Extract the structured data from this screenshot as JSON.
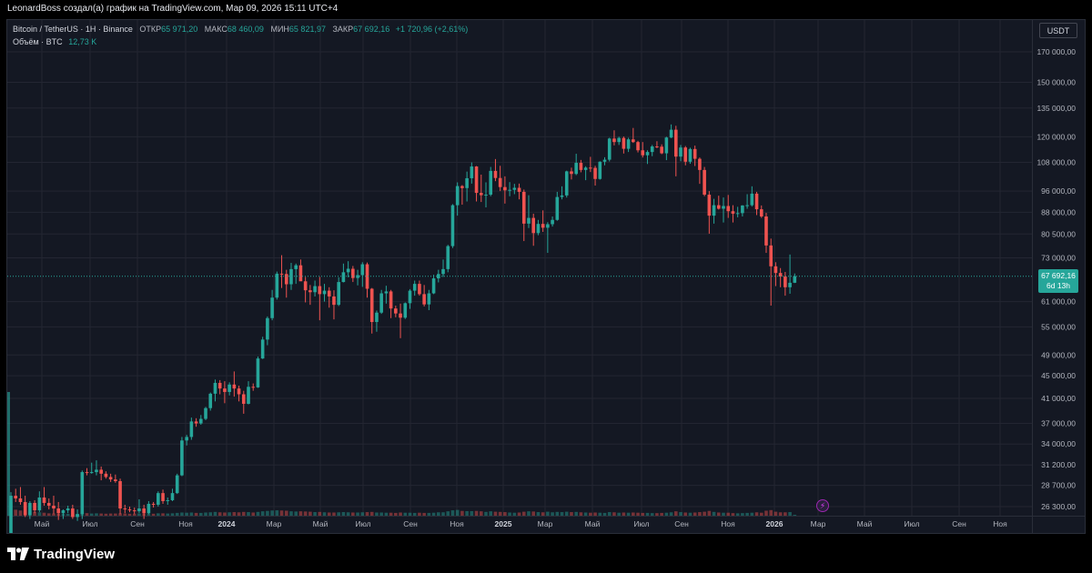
{
  "caption": "LeonardBoss создал(а) график на TradingView.com, Мар 09, 2026 15:11 UTC+4",
  "legend": {
    "symbol": "Bitcoin / TetherUS · 1Н · Binance",
    "open_label": "ОТКР",
    "open_value": "65 971,20",
    "high_label": "МАКС",
    "high_value": "68 460,09",
    "low_label": "МИН",
    "low_value": "65 821,97",
    "close_label": "ЗАКР",
    "close_value": "67 692,16",
    "change": "+1 720,96 (+2,61%)",
    "volume_label": "Объём · BTC",
    "volume_value": "12,73 K"
  },
  "currency": "USDT",
  "last_price": {
    "price": "67 692,16",
    "countdown": "6d 13h"
  },
  "logo_text": "TradingView",
  "icons": {
    "flash": "lightning-icon",
    "logo": "tradingview-logo-icon"
  },
  "colors": {
    "up": "#26a69a",
    "down": "#ef5350",
    "background": "#141823",
    "grid": "#232632"
  },
  "chart_data": {
    "type": "candlestick",
    "scale": "log",
    "interval": "1W",
    "grid": true,
    "y_ticks": [
      26300,
      28700,
      31200,
      34000,
      37000,
      41000,
      45000,
      49000,
      55000,
      61000,
      67692.16,
      73000,
      80500,
      88000,
      96000,
      108000,
      120000,
      135000,
      150000,
      170000
    ],
    "y_tick_labels": [
      "26 300,00",
      "28 700,00",
      "31 200,00",
      "34 000,00",
      "37 000,00",
      "41 000,00",
      "45 000,00",
      "49 000,00",
      "55 000,00",
      "61 000,00",
      "67 692,16",
      "73 000,00",
      "80 500,00",
      "88 000,00",
      "96 000,00",
      "108 000,00",
      "120 000,00",
      "135 000,00",
      "150 000,00",
      "170 000,00"
    ],
    "x_tick_labels": [
      "Май",
      "Июл",
      "Сен",
      "Ноя",
      "2024",
      "Мар",
      "Май",
      "Июл",
      "Сен",
      "Ноя",
      "2025",
      "Мар",
      "Май",
      "Июл",
      "Сен",
      "Ноя",
      "2026",
      "Мар",
      "Май",
      "Июл",
      "Сен",
      "Ноя"
    ],
    "x_tick_bold": [
      false,
      false,
      false,
      false,
      true,
      false,
      false,
      false,
      false,
      false,
      true,
      false,
      false,
      false,
      false,
      false,
      true,
      false,
      false,
      false,
      false,
      false
    ],
    "candles": [
      [
        23500,
        27900,
        22500,
        27500,
        70
      ],
      [
        27500,
        28300,
        26800,
        27200,
        30
      ],
      [
        27200,
        28500,
        26500,
        26800,
        26
      ],
      [
        26800,
        27500,
        25200,
        25400,
        22
      ],
      [
        25400,
        26900,
        25000,
        26700,
        21
      ],
      [
        26700,
        27000,
        25600,
        25900,
        19
      ],
      [
        25900,
        28000,
        25700,
        27300,
        17
      ],
      [
        27300,
        28500,
        26400,
        26700,
        15
      ],
      [
        26700,
        27200,
        26000,
        26400,
        12
      ],
      [
        26400,
        27500,
        25500,
        26100,
        11
      ],
      [
        26100,
        26800,
        24900,
        25600,
        10
      ],
      [
        25600,
        26000,
        25000,
        25900,
        9
      ],
      [
        25900,
        26400,
        25600,
        26100,
        9
      ],
      [
        26100,
        26500,
        25000,
        25200,
        10
      ],
      [
        25200,
        26000,
        24800,
        25500,
        9
      ],
      [
        25500,
        30500,
        25000,
        30300,
        14
      ],
      [
        30300,
        30800,
        29900,
        30200,
        13
      ],
      [
        30200,
        31500,
        30100,
        30300,
        11
      ],
      [
        30300,
        31800,
        29900,
        30600,
        12
      ],
      [
        30600,
        31000,
        29300,
        30100,
        11
      ],
      [
        30100,
        30400,
        29500,
        29700,
        10
      ],
      [
        29700,
        30100,
        29100,
        29400,
        11
      ],
      [
        29400,
        30000,
        29000,
        29200,
        11
      ],
      [
        29200,
        29500,
        25500,
        26100,
        12
      ],
      [
        26100,
        26500,
        25600,
        26000,
        11
      ],
      [
        26000,
        26300,
        25700,
        25900,
        10
      ],
      [
        25900,
        26200,
        25500,
        25800,
        10
      ],
      [
        25800,
        27100,
        25600,
        26100,
        11
      ],
      [
        26100,
        26500,
        25000,
        25600,
        11
      ],
      [
        25600,
        26900,
        25500,
        26600,
        11
      ],
      [
        26600,
        26800,
        26200,
        26500,
        10
      ],
      [
        26500,
        28000,
        26300,
        27800,
        12
      ],
      [
        27800,
        28200,
        26600,
        26900,
        12
      ],
      [
        26900,
        27300,
        26500,
        27000,
        11
      ],
      [
        27000,
        28300,
        26900,
        27800,
        12
      ],
      [
        27800,
        30100,
        27700,
        29900,
        14
      ],
      [
        29900,
        35000,
        29800,
        34500,
        16
      ],
      [
        34500,
        35300,
        33800,
        35000,
        15
      ],
      [
        35000,
        37900,
        34600,
        37300,
        16
      ],
      [
        37300,
        37800,
        36500,
        37000,
        14
      ],
      [
        37000,
        38300,
        36800,
        37700,
        14
      ],
      [
        37700,
        39600,
        37500,
        39400,
        16
      ],
      [
        39400,
        42000,
        39000,
        41800,
        17
      ],
      [
        41800,
        44300,
        40500,
        43700,
        19
      ],
      [
        43700,
        44200,
        41700,
        42700,
        17
      ],
      [
        42700,
        44000,
        40200,
        42100,
        16
      ],
      [
        42100,
        43800,
        41500,
        43400,
        17
      ],
      [
        43400,
        45800,
        41300,
        42700,
        18
      ],
      [
        42700,
        43200,
        40500,
        41700,
        17
      ],
      [
        41700,
        42300,
        38500,
        40100,
        19
      ],
      [
        40100,
        44000,
        40000,
        43000,
        18
      ],
      [
        43000,
        43600,
        42300,
        42900,
        16
      ],
      [
        42900,
        48700,
        42800,
        48300,
        19
      ],
      [
        48300,
        52800,
        48200,
        52200,
        22
      ],
      [
        52200,
        57400,
        51000,
        57000,
        24
      ],
      [
        57000,
        64000,
        56500,
        62000,
        26
      ],
      [
        62000,
        69000,
        61500,
        68400,
        27
      ],
      [
        68400,
        73800,
        64500,
        68300,
        26
      ],
      [
        68300,
        69500,
        62000,
        65500,
        25
      ],
      [
        65500,
        71500,
        64000,
        69700,
        22
      ],
      [
        69700,
        71300,
        65600,
        70800,
        21
      ],
      [
        70800,
        72500,
        67000,
        66300,
        22
      ],
      [
        66300,
        67500,
        60800,
        63900,
        21
      ],
      [
        63900,
        65300,
        60200,
        63400,
        20
      ],
      [
        63400,
        66500,
        62300,
        65000,
        18
      ],
      [
        65000,
        67500,
        56500,
        62900,
        19
      ],
      [
        62900,
        65600,
        61000,
        63800,
        17
      ],
      [
        63800,
        64700,
        59500,
        62300,
        16
      ],
      [
        62300,
        63900,
        56700,
        60200,
        16
      ],
      [
        60200,
        67400,
        59900,
        66100,
        17
      ],
      [
        66100,
        71300,
        66000,
        68800,
        18
      ],
      [
        68800,
        72000,
        67400,
        69800,
        17
      ],
      [
        69800,
        70600,
        66100,
        67200,
        16
      ],
      [
        67200,
        69500,
        65200,
        68000,
        16
      ],
      [
        68000,
        71700,
        64800,
        71100,
        17
      ],
      [
        71100,
        71600,
        62000,
        64300,
        18
      ],
      [
        64300,
        64500,
        53500,
        56100,
        19
      ],
      [
        56100,
        58800,
        53900,
        58300,
        16
      ],
      [
        58300,
        64000,
        58000,
        63100,
        16
      ],
      [
        63100,
        65100,
        60500,
        63600,
        15
      ],
      [
        63600,
        64000,
        57000,
        59300,
        15
      ],
      [
        59300,
        60000,
        57200,
        58100,
        14
      ],
      [
        58100,
        60500,
        52500,
        57100,
        16
      ],
      [
        57100,
        60800,
        56800,
        60600,
        15
      ],
      [
        60600,
        64200,
        59200,
        63800,
        15
      ],
      [
        63800,
        66500,
        62500,
        65600,
        14
      ],
      [
        65600,
        66500,
        62500,
        62900,
        15
      ],
      [
        62900,
        65300,
        59800,
        60300,
        14
      ],
      [
        60300,
        64000,
        58900,
        63100,
        14
      ],
      [
        63100,
        68100,
        62900,
        67100,
        15
      ],
      [
        67100,
        69500,
        66000,
        68300,
        17
      ],
      [
        68300,
        72500,
        67500,
        69700,
        17
      ],
      [
        69700,
        77000,
        68800,
        76600,
        22
      ],
      [
        76600,
        91000,
        76000,
        90600,
        27
      ],
      [
        90600,
        99500,
        86800,
        98000,
        29
      ],
      [
        98000,
        98400,
        90800,
        97200,
        24
      ],
      [
        97200,
        104000,
        92000,
        101200,
        23
      ],
      [
        101200,
        108000,
        99000,
        106200,
        23
      ],
      [
        106200,
        106400,
        92000,
        95300,
        24
      ],
      [
        95300,
        102700,
        91800,
        94400,
        22
      ],
      [
        94400,
        99500,
        89800,
        94600,
        19
      ],
      [
        94600,
        106000,
        94000,
        104300,
        22
      ],
      [
        104300,
        109500,
        100000,
        101300,
        20
      ],
      [
        101300,
        106500,
        96000,
        97600,
        19
      ],
      [
        97600,
        102000,
        91200,
        96300,
        18
      ],
      [
        96300,
        99600,
        94000,
        96500,
        16
      ],
      [
        96500,
        98900,
        94800,
        97300,
        15
      ],
      [
        97300,
        99000,
        92800,
        95700,
        16
      ],
      [
        95700,
        96600,
        78200,
        84000,
        20
      ],
      [
        84000,
        94400,
        82500,
        86000,
        22
      ],
      [
        86000,
        87500,
        76700,
        80800,
        21
      ],
      [
        80800,
        85300,
        80100,
        83900,
        18
      ],
      [
        83900,
        88700,
        81200,
        82600,
        17
      ],
      [
        82600,
        84500,
        74500,
        83800,
        20
      ],
      [
        83800,
        86500,
        83000,
        85300,
        17
      ],
      [
        85300,
        95700,
        85000,
        93700,
        19
      ],
      [
        93700,
        97900,
        92800,
        94300,
        18
      ],
      [
        94300,
        104400,
        93500,
        104100,
        20
      ],
      [
        104100,
        105700,
        100700,
        103000,
        18
      ],
      [
        103000,
        111900,
        102500,
        107800,
        19
      ],
      [
        107800,
        109100,
        103700,
        104700,
        17
      ],
      [
        104700,
        106300,
        100400,
        105700,
        16
      ],
      [
        105700,
        110500,
        103800,
        105600,
        15
      ],
      [
        105600,
        106500,
        98200,
        100900,
        16
      ],
      [
        100900,
        108500,
        100600,
        108300,
        15
      ],
      [
        108300,
        110300,
        106700,
        109200,
        14
      ],
      [
        109200,
        119500,
        108400,
        119100,
        18
      ],
      [
        119100,
        123200,
        115800,
        117400,
        17
      ],
      [
        117400,
        120000,
        116000,
        119400,
        15
      ],
      [
        119400,
        120100,
        112000,
        114200,
        16
      ],
      [
        114200,
        119500,
        112700,
        118700,
        15
      ],
      [
        118700,
        124400,
        117000,
        117400,
        16
      ],
      [
        117400,
        118000,
        112500,
        113500,
        15
      ],
      [
        113500,
        117400,
        110200,
        111200,
        14
      ],
      [
        111200,
        113500,
        107300,
        112700,
        14
      ],
      [
        112700,
        116000,
        110800,
        115300,
        13
      ],
      [
        115300,
        117800,
        114500,
        115200,
        13
      ],
      [
        115200,
        116300,
        111700,
        112100,
        14
      ],
      [
        112100,
        120000,
        109000,
        119600,
        15
      ],
      [
        119600,
        126200,
        119300,
        123500,
        17
      ],
      [
        123500,
        125500,
        102000,
        110600,
        22
      ],
      [
        110600,
        116000,
        108500,
        114800,
        18
      ],
      [
        114800,
        115500,
        106700,
        108300,
        16
      ],
      [
        108300,
        114700,
        107400,
        114100,
        15
      ],
      [
        114100,
        115700,
        106400,
        109600,
        16
      ],
      [
        109600,
        110200,
        98900,
        104700,
        18
      ],
      [
        104700,
        106000,
        94000,
        94600,
        20
      ],
      [
        94600,
        96000,
        80600,
        86800,
        24
      ],
      [
        86800,
        93000,
        84000,
        90600,
        19
      ],
      [
        90600,
        94200,
        89000,
        89300,
        16
      ],
      [
        89300,
        93500,
        84400,
        90300,
        15
      ],
      [
        90300,
        94500,
        86000,
        88400,
        15
      ],
      [
        88400,
        90600,
        84400,
        87500,
        13
      ],
      [
        87500,
        90000,
        86200,
        87700,
        12
      ],
      [
        87700,
        90600,
        86500,
        90500,
        13
      ],
      [
        90500,
        94800,
        89300,
        90600,
        14
      ],
      [
        90600,
        97900,
        90100,
        95000,
        15
      ],
      [
        95000,
        95700,
        87000,
        89100,
        17
      ],
      [
        89100,
        90500,
        86000,
        86500,
        15
      ],
      [
        86500,
        87800,
        74500,
        76800,
        25
      ],
      [
        76800,
        79000,
        60000,
        70500,
        28
      ],
      [
        70500,
        71700,
        65000,
        68600,
        20
      ],
      [
        68600,
        70000,
        64700,
        67600,
        17
      ],
      [
        67600,
        68900,
        62500,
        64700,
        17
      ],
      [
        64700,
        74000,
        63000,
        65900,
        18
      ],
      [
        65900,
        68460,
        65822,
        67692,
        2
      ]
    ]
  }
}
